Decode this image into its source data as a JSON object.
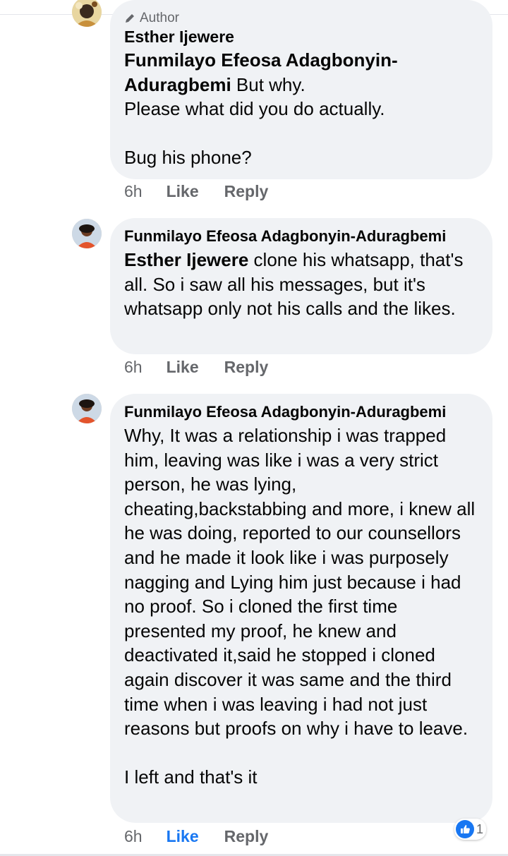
{
  "comments": [
    {
      "badge": "Author",
      "author": "Esther Ijewere",
      "mention": "Funmilayo Efeosa Adagbonyin-Aduragbemi",
      "text": " But why.\nPlease what did you do actually.\n\nBug his phone?",
      "time": "6h",
      "like_label": "Like",
      "reply_label": "Reply"
    },
    {
      "author": "Funmilayo Efeosa Adagbonyin-Aduragbemi",
      "mention": "Esther Ijewere",
      "text": " clone his whatsapp, that's all. So i saw all his messages, but it's whatsapp only not his calls and the likes.",
      "time": "6h",
      "like_label": "Like",
      "reply_label": "Reply"
    },
    {
      "author": "Funmilayo Efeosa Adagbonyin-Aduragbemi",
      "text": "Why, It was a relationship i was trapped him, leaving was like i was a very strict person, he was lying, cheating,backstabbing and more, i knew all he was doing, reported to our counsellors and he made it look like i was purposely nagging and Lying him just because i had no proof. So i cloned the first time presented my proof, he knew and deactivated it,said he stopped i cloned again discover it was same and the third time when i was leaving i had not just reasons but proofs on why i have to leave.\n\nI left and that's it",
      "time": "6h",
      "like_label": "Like",
      "reply_label": "Reply",
      "reaction_count": "1"
    }
  ],
  "colors": {
    "bubble": "#f0f2f5",
    "meta": "#65676b",
    "like_active": "#1877f2"
  }
}
